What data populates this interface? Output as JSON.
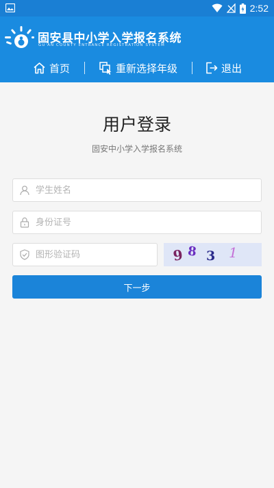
{
  "status_bar": {
    "time": "2:52",
    "icons": [
      "gallery-icon",
      "wifi-icon",
      "no-signal-icon",
      "battery-icon"
    ]
  },
  "header": {
    "title": "固安县中小学入学报名系统",
    "subtitle": "GU'AN COUNTY ENTRANCE REGISTRATION SYSTEM",
    "nav": [
      {
        "label": "首页",
        "icon": "home-icon"
      },
      {
        "label": "重新选择年级",
        "icon": "reselect-icon"
      },
      {
        "label": "退出",
        "icon": "logout-icon"
      }
    ]
  },
  "login": {
    "title": "用户登录",
    "subtitle": "固安中小学入学报名系统",
    "name_placeholder": "学生姓名",
    "id_placeholder": "身份证号",
    "captcha_placeholder": "图形验证码",
    "captcha_code": [
      "9",
      "8",
      "3",
      "1"
    ],
    "next_label": "下一步"
  },
  "colors": {
    "status_bar": "#1a7fd4",
    "header": "#1a8be0",
    "button": "#1b84d9",
    "background": "#f5f5f5"
  }
}
